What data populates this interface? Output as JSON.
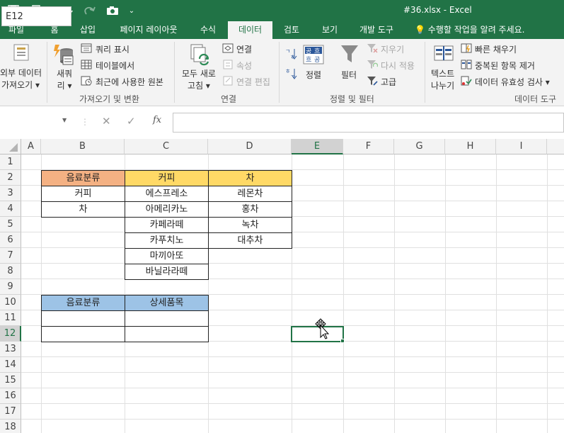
{
  "window": {
    "title": "#36.xlsx - Excel"
  },
  "tabs": [
    "파일",
    "홈",
    "삽입",
    "페이지 레이아웃",
    "수식",
    "데이터",
    "검토",
    "보기",
    "개발 도구"
  ],
  "active_tab": "데이터",
  "tell_me": "수행할 작업을 알려 주세요.",
  "ribbon": {
    "get_external": {
      "line1": "외부 데이터",
      "line2": "가져오기 ▾"
    },
    "new_query": {
      "line1": "새쿼",
      "line2": "리 ▾"
    },
    "show_queries": "쿼리 표시",
    "from_table": "테이블에서",
    "recent_sources": "최근에 사용한 원본",
    "group_get_transform": "가져오기 및 변환",
    "refresh_all": {
      "line1": "모두 새로",
      "line2": "고침 ▾"
    },
    "connections": "연결",
    "properties": "속성",
    "edit_links": "연결 편집",
    "group_connections": "연결",
    "sort": "정렬",
    "filter": "필터",
    "clear": "지우기",
    "reapply": "다시 적용",
    "advanced": "고급",
    "group_sort_filter": "정렬 및 필터",
    "text_to_columns": {
      "line1": "텍스트",
      "line2": "나누기"
    },
    "flash_fill": "빠른 채우기",
    "remove_duplicates": "중복된 항목 제거",
    "data_validation": "데이터 유효성 검사 ▾",
    "group_data_tools": "데이터 도구"
  },
  "formula_bar": {
    "name_box": "E12",
    "formula": ""
  },
  "columns": [
    "A",
    "B",
    "C",
    "D",
    "E",
    "F",
    "G",
    "H",
    "I"
  ],
  "rows": [
    "1",
    "2",
    "3",
    "4",
    "5",
    "6",
    "7",
    "8",
    "9",
    "10",
    "11",
    "12",
    "13",
    "14",
    "15",
    "16",
    "17",
    "18"
  ],
  "table1": {
    "headers": [
      "음료분류",
      "커피",
      "차"
    ],
    "col_b": [
      "커피",
      "차"
    ],
    "col_c": [
      "에스프레소",
      "아메리카노",
      "카페라떼",
      "카푸치노",
      "마끼아또",
      "바닐라라떼"
    ],
    "col_d": [
      "레몬차",
      "홍차",
      "녹차",
      "대추차"
    ]
  },
  "table2": {
    "headers": [
      "음료분류",
      "상세품목"
    ]
  },
  "colors": {
    "excel_green": "#217346",
    "header_orange": "#f4b183",
    "header_yellow": "#ffd966",
    "header_blue": "#9dc3e6"
  }
}
